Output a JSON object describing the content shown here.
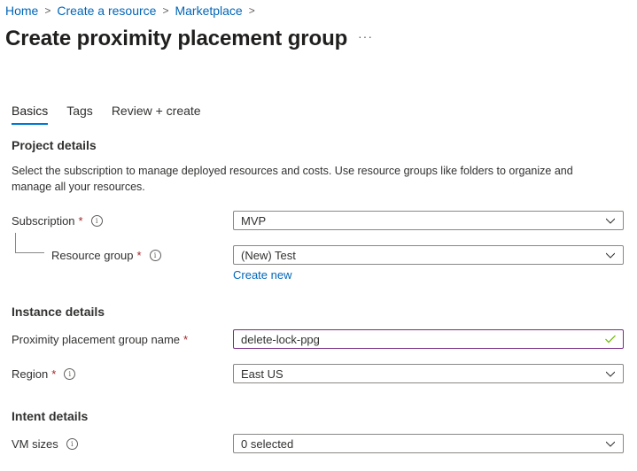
{
  "breadcrumb": {
    "items": [
      "Home",
      "Create a resource",
      "Marketplace"
    ],
    "separator": ">"
  },
  "page": {
    "title": "Create proximity placement group",
    "more_label": "···"
  },
  "tabs": [
    {
      "label": "Basics",
      "active": true
    },
    {
      "label": "Tags",
      "active": false
    },
    {
      "label": "Review + create",
      "active": false
    }
  ],
  "project_details": {
    "heading": "Project details",
    "description": "Select the subscription to manage deployed resources and costs. Use resource groups like folders to organize and manage all your resources.",
    "subscription": {
      "label": "Subscription",
      "required_mark": "*",
      "value": "MVP"
    },
    "resource_group": {
      "label": "Resource group",
      "required_mark": "*",
      "value": "(New) Test",
      "create_new_label": "Create new"
    }
  },
  "instance_details": {
    "heading": "Instance details",
    "ppg_name": {
      "label": "Proximity placement group name",
      "required_mark": "*",
      "value": "delete-lock-ppg",
      "valid": true
    },
    "region": {
      "label": "Region",
      "required_mark": "*",
      "value": "East US"
    }
  },
  "intent_details": {
    "heading": "Intent details",
    "vm_sizes": {
      "label": "VM sizes",
      "value": "0 selected"
    }
  },
  "icons": {
    "info": "i",
    "chevron": "chevron-down-icon",
    "check": "checkmark-icon"
  },
  "colors": {
    "accent": "#0078d4",
    "link": "#0066b8",
    "required": "#a4262c",
    "input_focus_border": "#7a2a86",
    "valid_check": "#6bb700"
  }
}
